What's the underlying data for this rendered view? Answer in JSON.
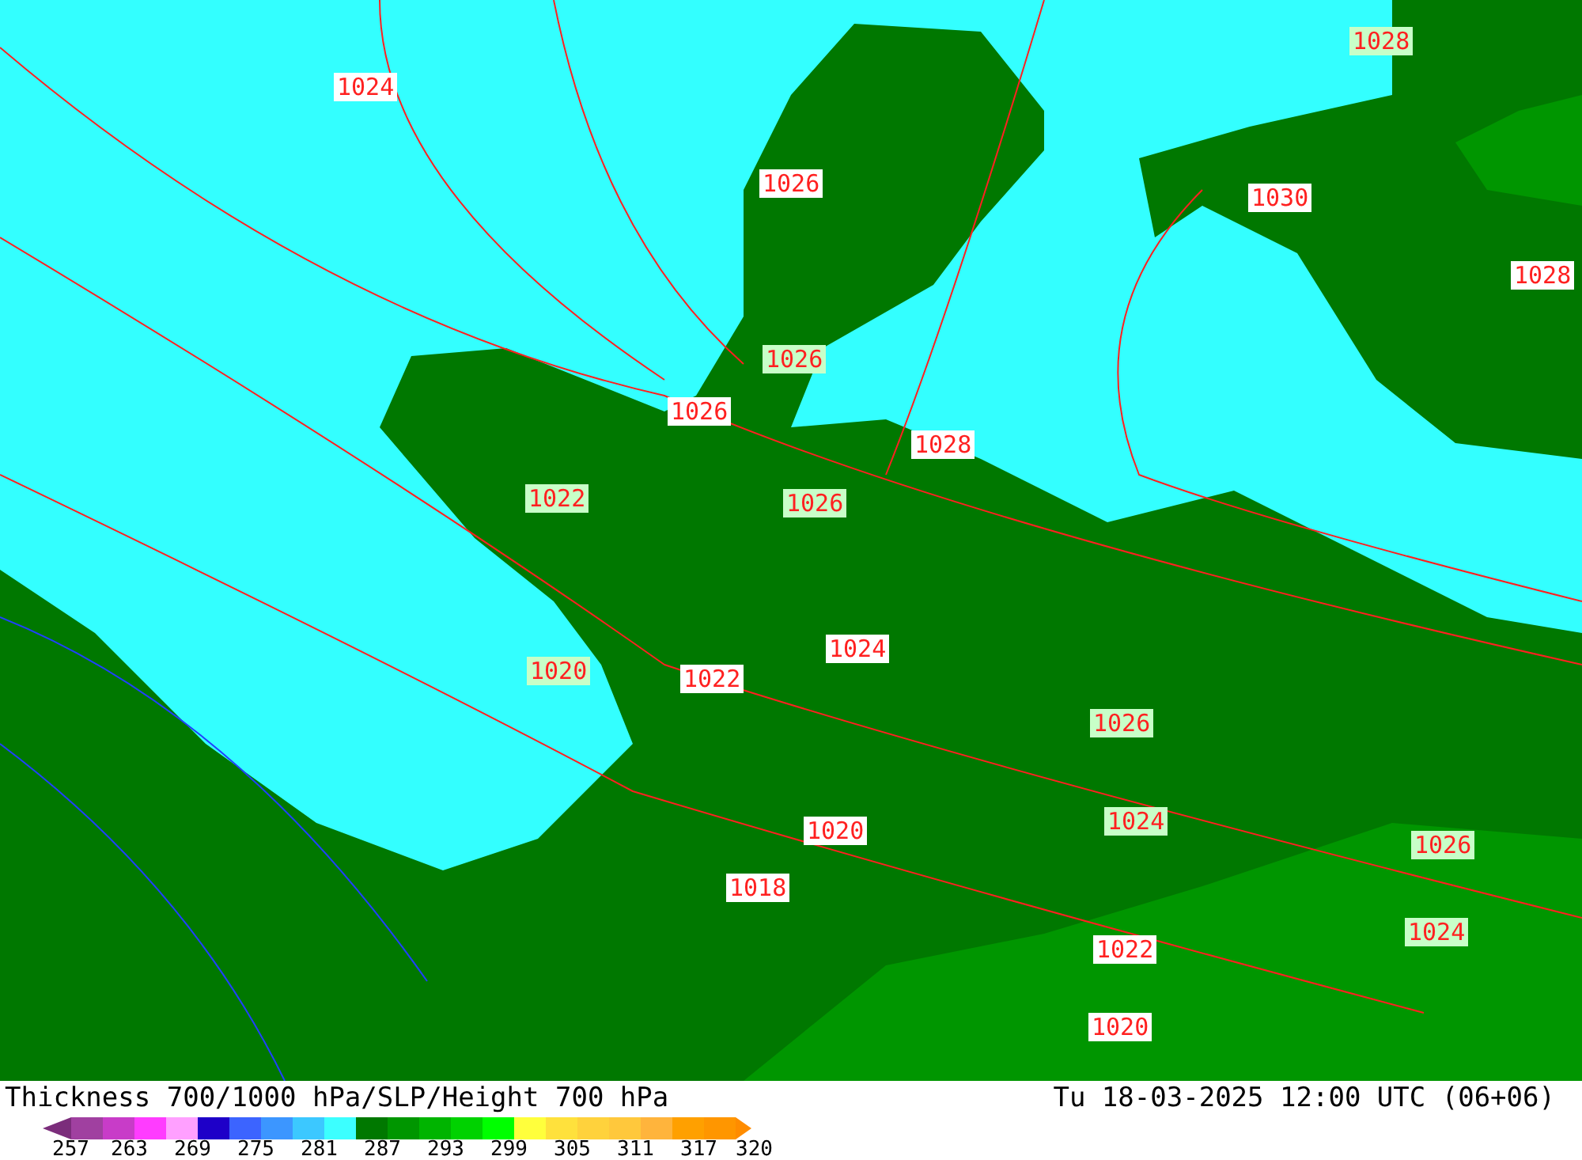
{
  "map": {
    "isobar_labels": [
      {
        "text": "1024",
        "color": "#ffffff"
      },
      {
        "text": "1028",
        "color": "#c8ffc8"
      },
      {
        "text": "1026",
        "color": "#ffffff"
      },
      {
        "text": "1030",
        "color": "#ffffff"
      },
      {
        "text": "1028",
        "color": "#ffffff"
      },
      {
        "text": "1026",
        "color": "#c8ffc8"
      },
      {
        "text": "1026",
        "color": "#ffffff"
      },
      {
        "text": "1028",
        "color": "#ffffff"
      },
      {
        "text": "1022",
        "color": "#c8ffc8"
      },
      {
        "text": "1026",
        "color": "#c8ffc8"
      },
      {
        "text": "1024",
        "color": "#ffffff"
      },
      {
        "text": "1020",
        "color": "#c8ffc8"
      },
      {
        "text": "1022",
        "color": "#ffffff"
      },
      {
        "text": "1026",
        "color": "#c8ffc8"
      },
      {
        "text": "1024",
        "color": "#c8ffc8"
      },
      {
        "text": "1020",
        "color": "#ffffff"
      },
      {
        "text": "1026",
        "color": "#c8ffc8"
      },
      {
        "text": "1018",
        "color": "#ffffff"
      },
      {
        "text": "1022",
        "color": "#ffffff"
      },
      {
        "text": "1024",
        "color": "#c8ffc8"
      },
      {
        "text": "1020",
        "color": "#ffffff"
      }
    ]
  },
  "title": "Thickness 700/1000 hPa/SLP/Height 700 hPa",
  "valid_time": "Tu 18-03-2025 12:00 UTC (06+06)",
  "legend": {
    "colors": [
      {
        "kind": "arrow",
        "color": "#7b2d7b"
      },
      {
        "color": "#a040a0"
      },
      {
        "color": "#c83cc8"
      },
      {
        "color": "#ff3cff"
      },
      {
        "color": "#ffa0ff"
      },
      {
        "color": "#1e00c8"
      },
      {
        "color": "#3c64ff"
      },
      {
        "color": "#3c96ff"
      },
      {
        "color": "#3cc8ff"
      },
      {
        "color": "#3cffff"
      },
      {
        "color": "#007800"
      },
      {
        "color": "#009600"
      },
      {
        "color": "#00b400"
      },
      {
        "color": "#00d200"
      },
      {
        "color": "#00ff00"
      },
      {
        "color": "#ffff3c"
      },
      {
        "color": "#ffe13c"
      },
      {
        "color": "#ffd23c"
      },
      {
        "color": "#ffc83c"
      },
      {
        "color": "#ffb43c"
      },
      {
        "color": "#ffa000"
      },
      {
        "color": "#ff9600"
      },
      {
        "kind": "arrow",
        "color": "#ff8c00"
      }
    ],
    "ticks": [
      "257",
      "263",
      "269",
      "275",
      "281",
      "287",
      "293",
      "299",
      "305",
      "311",
      "317",
      "320"
    ]
  }
}
